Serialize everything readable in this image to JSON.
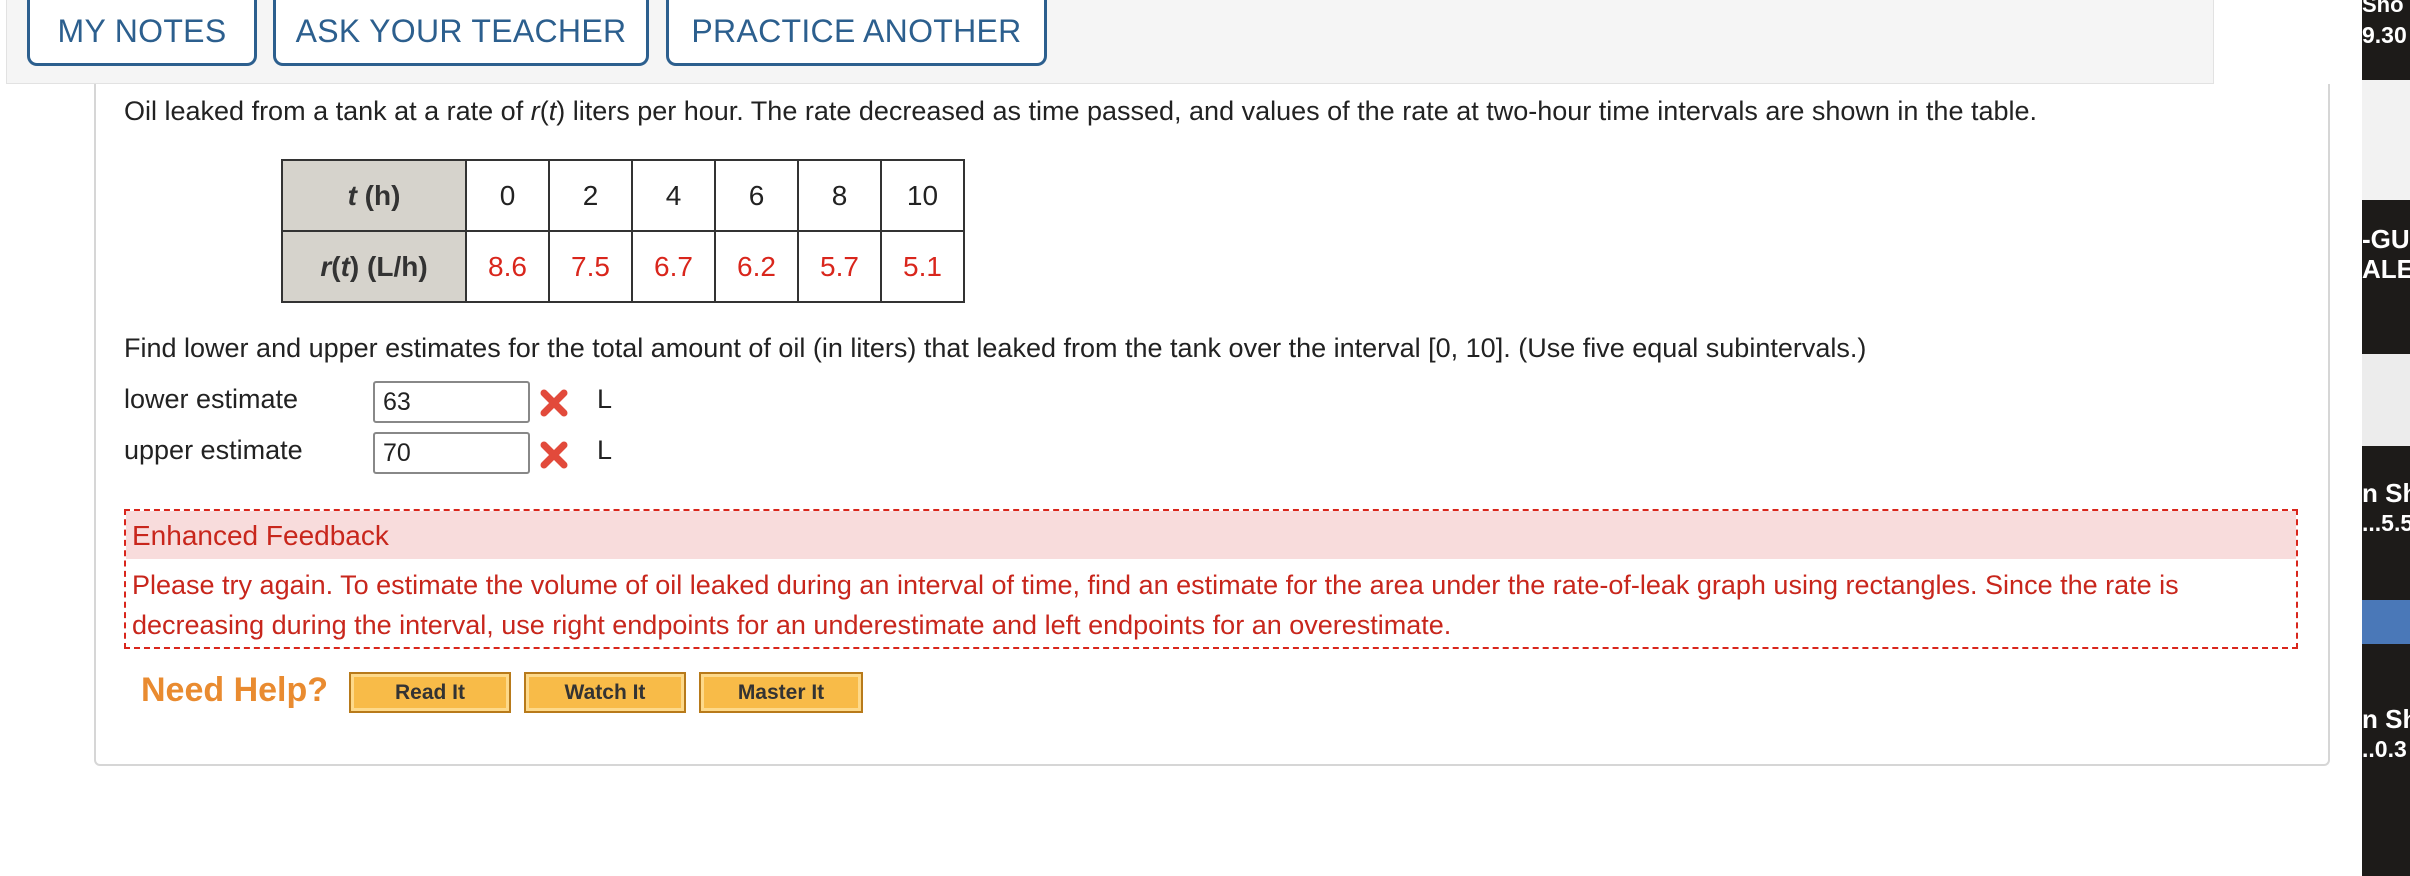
{
  "toolbar": {
    "my_notes": "MY NOTES",
    "ask_teacher": "ASK YOUR TEACHER",
    "practice_another": "PRACTICE ANOTHER"
  },
  "question": {
    "intro_1": "Oil leaked from a tank at a rate of ",
    "r_var": "r",
    "intro_2": "(",
    "t_var": "t",
    "intro_3": ") liters per hour. The rate decreased as time passed, and values of the rate at two-hour time intervals are shown in the table."
  },
  "table": {
    "row1_header_var": "t",
    "row1_header_unit": " (h)",
    "row2_header_var": "r",
    "row2_header_paren": "(",
    "row2_header_t": "t",
    "row2_header_unit": ") (L/h)",
    "t_values": [
      "0",
      "2",
      "4",
      "6",
      "8",
      "10"
    ],
    "r_values": [
      "8.6",
      "7.5",
      "6.7",
      "6.2",
      "5.7",
      "5.1"
    ]
  },
  "find_text": "Find lower and upper estimates for the total amount of oil (in liters) that leaked from the tank over the interval [0, 10]. (Use five equal subintervals.)",
  "answers": {
    "lower_label": "lower estimate",
    "lower_value": "63",
    "upper_label": "upper estimate",
    "upper_value": "70",
    "unit": "L",
    "status_icon": "incorrect-x-icon"
  },
  "feedback": {
    "title": "Enhanced Feedback",
    "body": "Please try again. To estimate the volume of oil leaked during an interval of time, find an estimate for the area under the rate-of-leak graph using rectangles. Since the rate is decreasing during the interval, use right endpoints for an underestimate and left endpoints for an overestimate."
  },
  "help": {
    "label": "Need Help?",
    "read_it": "Read It",
    "watch_it": "Watch It",
    "master_it": "Master It"
  },
  "side_strip": {
    "t1": "Sho",
    "t2": "9.30",
    "t3": "-GU",
    "t4": "ALES",
    "t5": "n Sh",
    "t6": "...5.5",
    "t7": "n Sh",
    "t8": "..0.3"
  },
  "colors": {
    "toolbar_blue": "#2c5f8e",
    "error_red": "#d9261c",
    "feedback_bg": "#f8dcdc",
    "help_orange": "#e98b30",
    "help_button": "#f8bb48"
  }
}
